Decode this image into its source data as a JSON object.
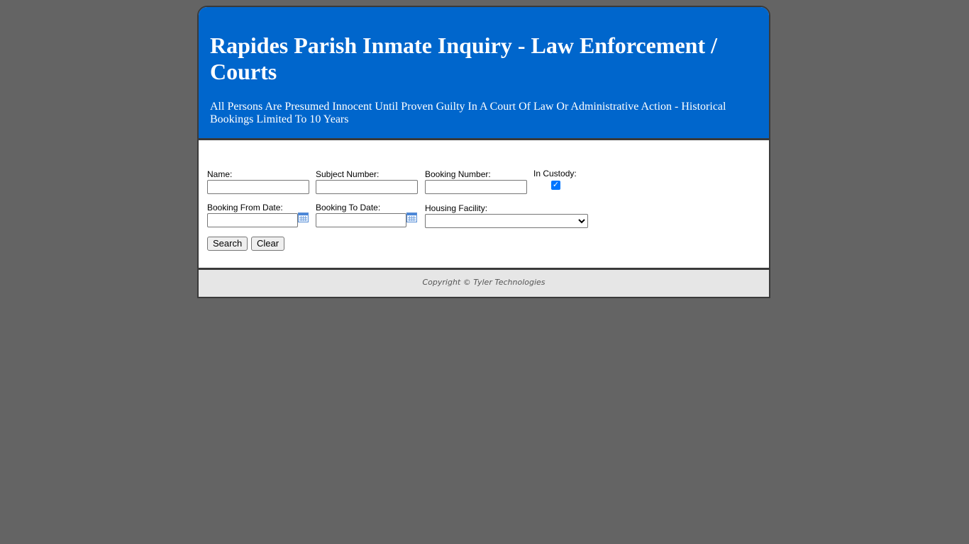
{
  "header": {
    "title": "Rapides Parish Inmate Inquiry - Law Enforcement / Courts",
    "subtitle": "All Persons Are Presumed Innocent Until Proven Guilty In A Court Of Law Or Administrative Action - Historical Bookings Limited To 10 Years"
  },
  "form": {
    "name_label": "Name:",
    "name_value": "",
    "subject_number_label": "Subject Number:",
    "subject_number_value": "",
    "booking_number_label": "Booking Number:",
    "booking_number_value": "",
    "in_custody_label": "In Custody:",
    "in_custody_checked": true,
    "booking_from_label": "Booking From Date:",
    "booking_from_value": "",
    "booking_to_label": "Booking To Date:",
    "booking_to_value": "",
    "housing_facility_label": "Housing Facility:",
    "housing_facility_value": "",
    "calendar_icon": "calendar-icon",
    "search_label": "Search",
    "clear_label": "Clear"
  },
  "footer": {
    "copyright": "Copyright © Tyler Technologies"
  },
  "colors": {
    "background": "#646464",
    "header": "#0066cc",
    "footer": "#e6e6e6",
    "checkbox": "#0075ff"
  }
}
